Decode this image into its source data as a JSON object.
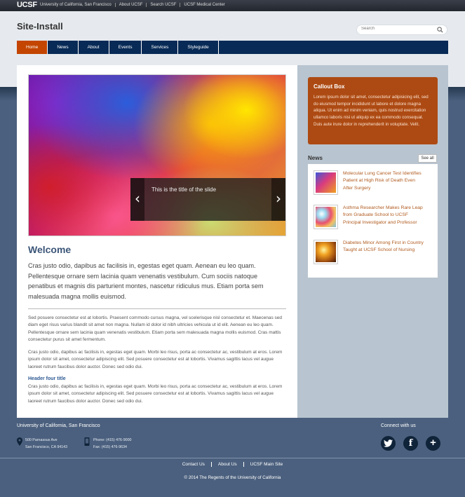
{
  "topbar": {
    "logo": "UCSF",
    "links": [
      "University of California, San Francisco",
      "About UCSF",
      "Search UCSF",
      "UCSF Medical Center"
    ]
  },
  "header": {
    "site_title": "Site-Install",
    "search_placeholder": "Search"
  },
  "nav": {
    "items": [
      "Home",
      "News",
      "About",
      "Events",
      "Services",
      "Styleguide"
    ],
    "active_color": "#c34500",
    "bar_color": "#072a56"
  },
  "slider": {
    "caption": "This is the title of the slide",
    "prev_icon": "chevron-left-icon",
    "next_icon": "chevron-right-icon"
  },
  "main": {
    "heading": "Welcome",
    "lead": "Cras justo odio, dapibus ac facilisis in, egestas eget quam. Aenean eu leo quam. Pellentesque ornare sem lacinia quam venenatis vestibulum. Cum sociis natoque penatibus et magnis dis parturient montes, nascetur ridiculus mus. Etiam porta sem malesuada magna mollis euismod.",
    "paragraph1": "Sed posuere consectetur est at lobortis. Praesent commodo cursus magna, vel scelerisque nisl consectetur et. Maecenas sed diam eget risus varius blandit sit amet non magna. Nullam id dolor id nibh ultricies vehicula ut id elit. Aenean eu leo quam. Pellentesque ornare sem lacinia quam venenatis vestibulum. Etiam porta sem malesuada magna mollis euismod. Cras mattis consectetur purus sit amet fermentum.",
    "paragraph2": "Cras justo odio, dapibus ac facilisis in, egestas eget quam. Morbi leo risus, porta ac consectetur ac, vestibulum at eros. Lorem ipsum dolor sit amet, consectetur adipiscing elit. Sed posuere consectetur est at lobortis. Vivamus sagittis lacus vel augue laoreet rutrum faucibus dolor auctor. Donec sed odio dui.",
    "header_four": "Header four title",
    "paragraph3": "Cras justo odio, dapibus ac facilisis in, egestas eget quam. Morbi leo risus, porta ac consectetur ac, vestibulum at eros. Lorem ipsum dolor sit amet, consectetur adipiscing elit. Sed posuere consectetur est at lobortis. Vivamus sagittis lacus vel augue laoreet rutrum faucibus dolor auctor. Donec sed odio dui."
  },
  "sidebar": {
    "callout_title": "Callout Box",
    "callout_body": "Lorem ipsum dolor sit amet, consectetur adipisicing elit, sed do eiusmod tempor incididunt ut labore et dolore magna aliqua. Ut enim ad minim veniam, quis nostrud exercitation ullamco laboris nisi ut aliquip ex ea commodo consequat. Duis aute irure dolor in reprehenderit in voluptate. Velit.",
    "callout_color": "#ad4a13",
    "news_heading": "News",
    "see_all": "See all",
    "news": [
      {
        "title": "Molecular Lung Cancer Test Identifies Patient at High Risk of Death Even After Surgery"
      },
      {
        "title": "Asthma Researcher Makes Rare Leap from Graduate School to UCSF Principal Investigator and Professor"
      },
      {
        "title": "Diabetes Minor Among First in Country Taught at UCSF School of Nursing"
      }
    ]
  },
  "footer": {
    "title": "University of California, San Francisco",
    "address_line1": "500 Parnassus Ave",
    "address_line2": "San Francisco, CA 94143",
    "phone": "Phone: (415) 476-9000",
    "fax": "Fax: (415) 476-9634",
    "connect": "Connect with us",
    "links": [
      "Contact Us",
      "About Us",
      "UCSF Main Site"
    ],
    "copyright": "© 2014 The Regents of the University of California"
  }
}
